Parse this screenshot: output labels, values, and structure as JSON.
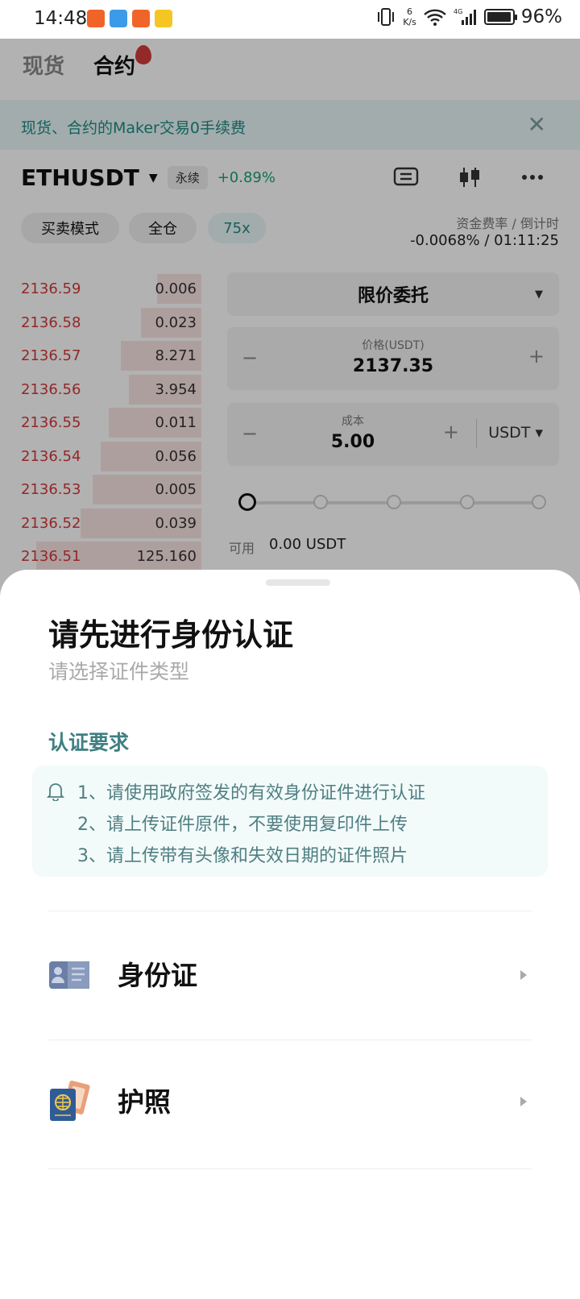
{
  "status_bar": {
    "time": "14:48",
    "net_speed_value": "6",
    "net_speed_unit": "K/s",
    "signal_label": "4G",
    "battery_percent": "96%",
    "battery_level": 0.96
  },
  "trading": {
    "tabs": [
      "现货",
      "合约"
    ],
    "banner_text": "现货、合约的Maker交易0手续费",
    "pair": "ETHUSDT",
    "contract_type": "永续",
    "change": "+0.89%",
    "mode_button": "买卖模式",
    "margin_button": "全仓",
    "leverage_button": "75x",
    "funding_label": "资金费率 / 倒计时",
    "funding_value": "-0.0068% / 01:11:25",
    "order_book": [
      {
        "price": "2136.59",
        "qty": "0.006",
        "depth": 0.22
      },
      {
        "price": "2136.58",
        "qty": "0.023",
        "depth": 0.3
      },
      {
        "price": "2136.57",
        "qty": "8.271",
        "depth": 0.4
      },
      {
        "price": "2136.56",
        "qty": "3.954",
        "depth": 0.36
      },
      {
        "price": "2136.55",
        "qty": "0.011",
        "depth": 0.46
      },
      {
        "price": "2136.54",
        "qty": "0.056",
        "depth": 0.5
      },
      {
        "price": "2136.53",
        "qty": "0.005",
        "depth": 0.54
      },
      {
        "price": "2136.52",
        "qty": "0.039",
        "depth": 0.6
      },
      {
        "price": "2136.51",
        "qty": "125.160",
        "depth": 0.82
      }
    ],
    "order_type": "限价委托",
    "price_label": "价格(USDT)",
    "price_value": "2137.35",
    "cost_label": "成本",
    "cost_value": "5.00",
    "cost_unit": "USDT",
    "available_label": "可用",
    "available_value": "0.00 USDT"
  },
  "sheet": {
    "title": "请先进行身份认证",
    "subtitle": "请选择证件类型",
    "requirements_title": "认证要求",
    "requirements": [
      "1、请使用政府签发的有效身份证件进行认证",
      "2、请上传证件原件，不要使用复印件上传",
      "3、请上传带有头像和失效日期的证件照片"
    ],
    "options": [
      {
        "label": "身份证",
        "icon": "id-card-icon"
      },
      {
        "label": "护照",
        "icon": "passport-icon"
      }
    ]
  },
  "colors": {
    "accent": "#1f8a85",
    "sell": "#d23a3a",
    "buy": "#1aa36e",
    "requirement_text": "#4f7f82"
  }
}
